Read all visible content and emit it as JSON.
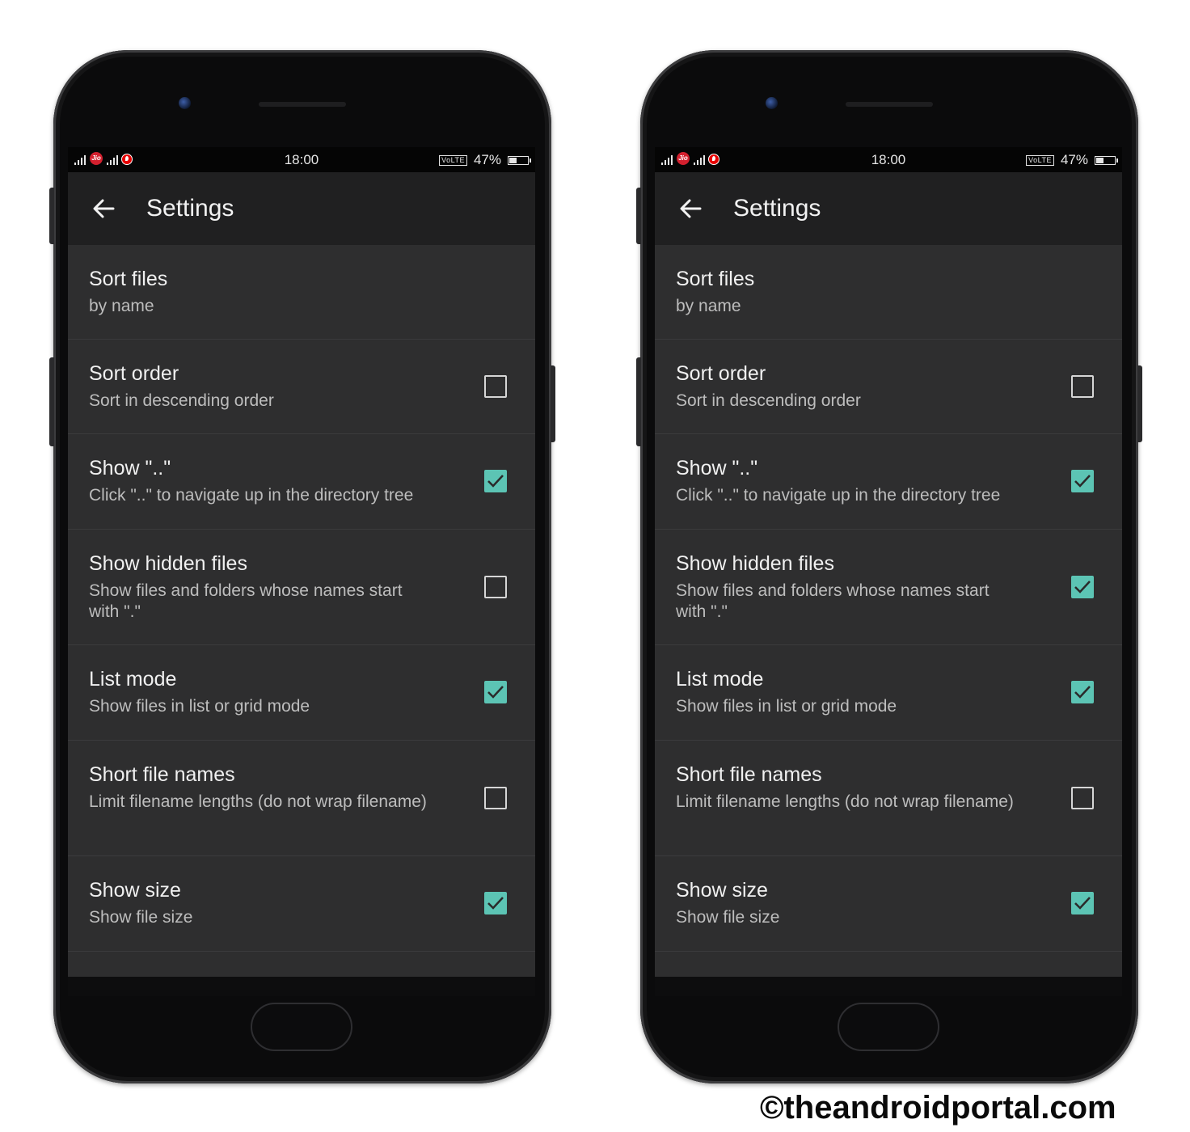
{
  "watermark": "©theandroidportal.com",
  "colors": {
    "accent": "#5cc4b4",
    "background": "#2e2e2f",
    "appbar": "#202021"
  },
  "phones": [
    {
      "statusbar": {
        "time": "18:00",
        "volte": "VoLTE",
        "battery": "47%",
        "carrier1": "Jio"
      },
      "appbar": {
        "title": "Settings",
        "back_icon": "arrow-back-icon"
      },
      "prefs": [
        {
          "title": "Sort files",
          "summary": "by name",
          "checkbox": null
        },
        {
          "title": "Sort order",
          "summary": "Sort in descending order",
          "checkbox": false
        },
        {
          "title": "Show \"..\"",
          "summary": "Click \"..\" to navigate up in the directory tree",
          "checkbox": true
        },
        {
          "title": "Show hidden files",
          "summary": "Show files and folders whose names start with \".\"",
          "checkbox": false
        },
        {
          "title": "List mode",
          "summary": "Show files in list or grid mode",
          "checkbox": true
        },
        {
          "title": "Short file names",
          "summary": "Limit filename lengths (do not wrap filename)",
          "checkbox": false
        },
        {
          "title": "Show size",
          "summary": "Show file size",
          "checkbox": true
        }
      ]
    },
    {
      "statusbar": {
        "time": "18:00",
        "volte": "VoLTE",
        "battery": "47%",
        "carrier1": "Jio"
      },
      "appbar": {
        "title": "Settings",
        "back_icon": "arrow-back-icon"
      },
      "prefs": [
        {
          "title": "Sort files",
          "summary": "by name",
          "checkbox": null
        },
        {
          "title": "Sort order",
          "summary": "Sort in descending order",
          "checkbox": false
        },
        {
          "title": "Show \"..\"",
          "summary": "Click \"..\" to navigate up in the directory tree",
          "checkbox": true
        },
        {
          "title": "Show hidden files",
          "summary": "Show files and folders whose names start with \".\"",
          "checkbox": true
        },
        {
          "title": "List mode",
          "summary": "Show files in list or grid mode",
          "checkbox": true
        },
        {
          "title": "Short file names",
          "summary": "Limit filename lengths (do not wrap filename)",
          "checkbox": false
        },
        {
          "title": "Show size",
          "summary": "Show file size",
          "checkbox": true
        }
      ]
    }
  ]
}
